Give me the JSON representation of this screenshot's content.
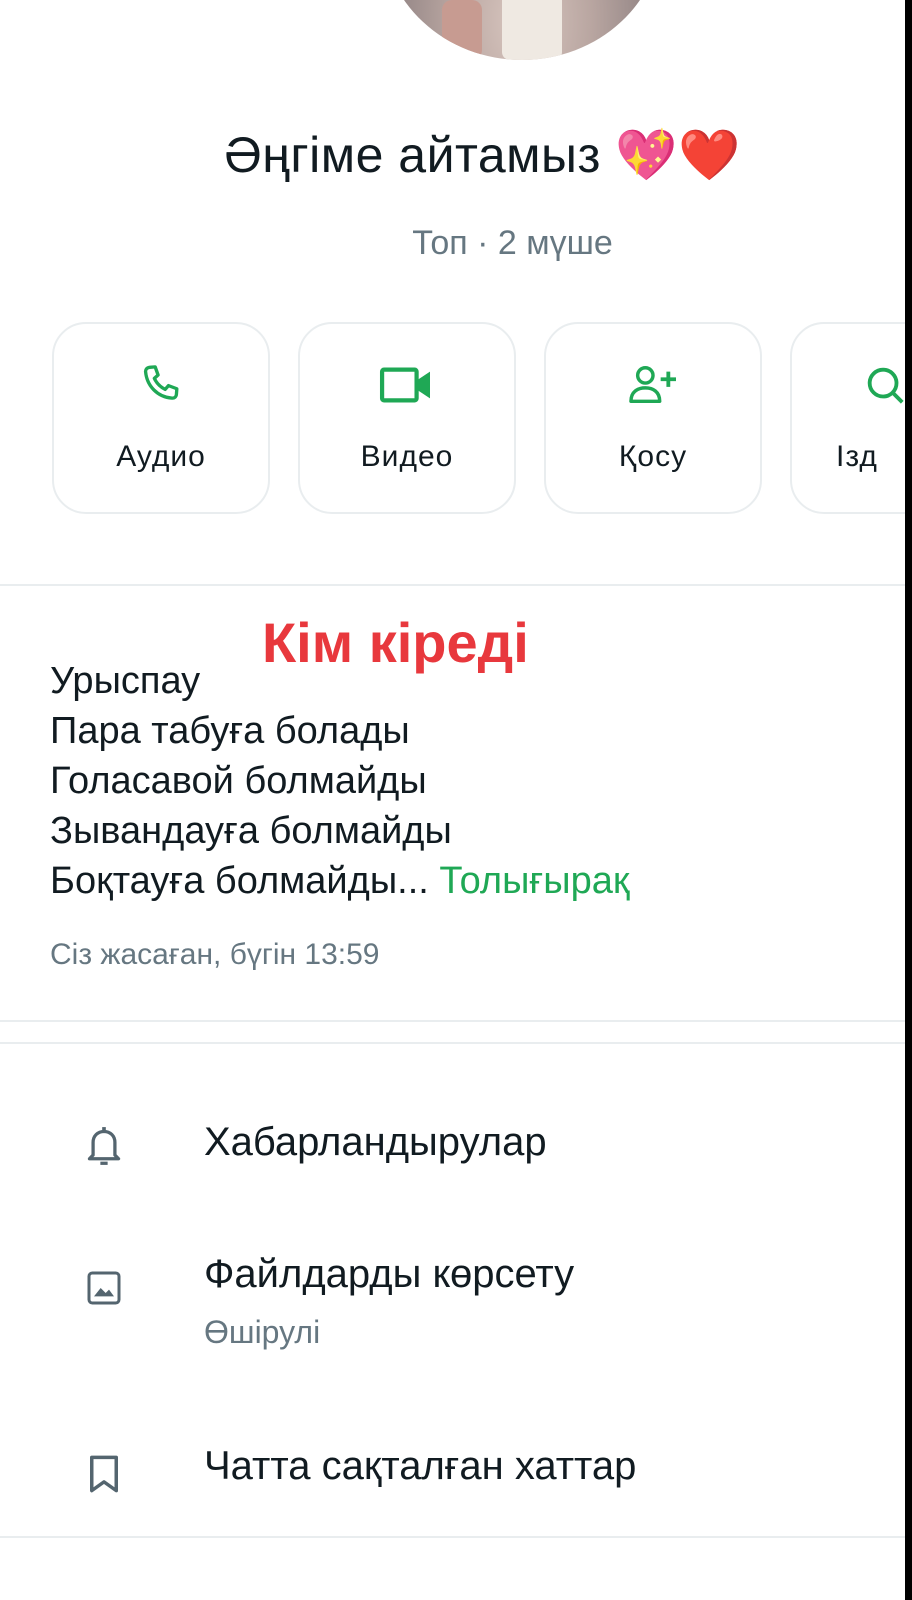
{
  "group": {
    "name": "Әңгіме айтамыз",
    "name_emoji": "💖❤️",
    "meta": "Топ · 2 мүше"
  },
  "actions": [
    {
      "label": "Аудио",
      "icon": "phone-icon"
    },
    {
      "label": "Видео",
      "icon": "video-icon"
    },
    {
      "label": "Қосу",
      "icon": "add-person-icon"
    },
    {
      "label": "Ізд",
      "icon": "search-icon"
    }
  ],
  "description": {
    "overlay_title": "Кім кіреді",
    "lines": [
      "Урыспау",
      "Пара табуға болады",
      "Голасавой болмайды",
      "Зывандауға болмайды",
      "Боқтауға болмайды..."
    ],
    "read_more": "Толығырақ",
    "created": "Сіз жасаған, бүгін 13:59"
  },
  "settings": {
    "notifications": {
      "label": "Хабарландырулар",
      "icon": "bell-icon"
    },
    "media_visibility": {
      "label": "Файлдарды көрсету",
      "sub": "Өшірулі",
      "icon": "image-icon"
    },
    "saved_messages": {
      "label": "Чатта сақталған хаттар",
      "icon": "bookmark-icon"
    }
  },
  "colors": {
    "accent_green": "#1fa855",
    "overlay_red": "#e8383d",
    "secondary_text": "#667781"
  }
}
